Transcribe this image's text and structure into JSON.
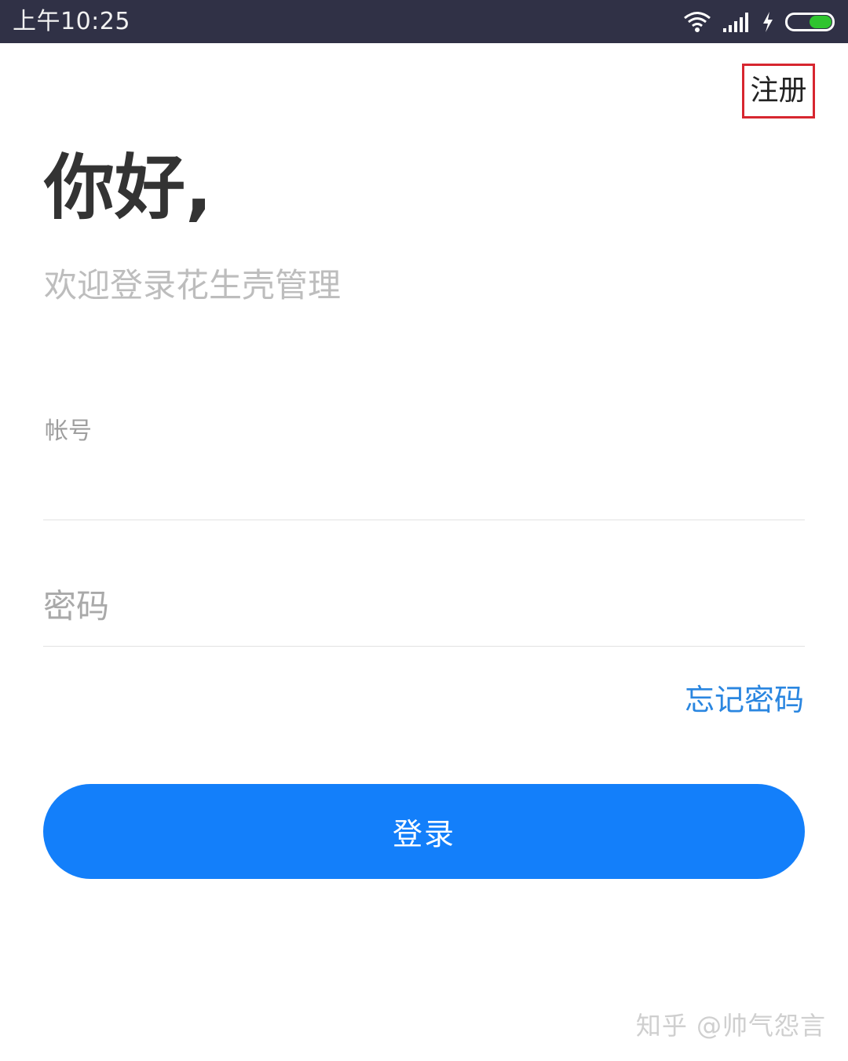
{
  "status_bar": {
    "time": "上午10:25",
    "icons": [
      "wifi-icon",
      "signal-icon",
      "charging-icon",
      "battery-icon"
    ],
    "battery_color": "#2fc42f"
  },
  "header": {
    "register_label": "注册",
    "highlight_color": "#d7262f"
  },
  "greeting": {
    "title": "你好,",
    "subtitle": "欢迎登录花生壳管理"
  },
  "form": {
    "account_label": "帐号",
    "account_value": "",
    "password_placeholder": "密码",
    "password_value": "",
    "forgot_label": "忘记密码",
    "login_label": "登录",
    "accent_color": "#137ffa"
  },
  "watermark": {
    "text": "知乎 @帅气怨言"
  }
}
